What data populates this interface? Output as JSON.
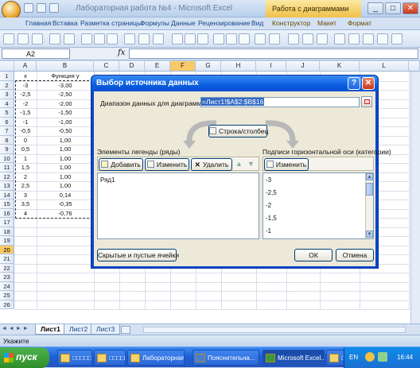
{
  "window": {
    "title": "Лабораторная работа №4 - Microsoft Excel",
    "context_tab": "Работа с диаграммами",
    "controls": {
      "minimize": "_",
      "maximize": "□",
      "close": "✕"
    }
  },
  "ribbon": {
    "tabs": [
      "Главная",
      "Вставка",
      "Разметка страницы",
      "Формулы",
      "Данные",
      "Рецензирование",
      "Вид",
      "Конструктор",
      "Макет",
      "Формат"
    ]
  },
  "formula_bar": {
    "name_box": "A2",
    "fx": "fx",
    "value": ""
  },
  "sheet": {
    "columns": [
      "A",
      "B",
      "C",
      "D",
      "E",
      "F",
      "G",
      "H",
      "I",
      "J",
      "K",
      "L"
    ],
    "rows": [
      "1",
      "2",
      "3",
      "4",
      "5",
      "6",
      "7",
      "8",
      "9",
      "10",
      "11",
      "12",
      "13",
      "14",
      "15",
      "16",
      "17",
      "18",
      "19",
      "20",
      "21",
      "22",
      "23",
      "24",
      "25",
      "26"
    ],
    "selected_rows": [
      "20"
    ],
    "header_row": {
      "a": "x",
      "b": "Функция y"
    },
    "data": [
      {
        "x": "-3",
        "y": "-3,00"
      },
      {
        "x": "-2,5",
        "y": "-2,50"
      },
      {
        "x": "-2",
        "y": "-2,00"
      },
      {
        "x": "-1,5",
        "y": "-1,50"
      },
      {
        "x": "-1",
        "y": "-1,00"
      },
      {
        "x": "-0,5",
        "y": "-0,50"
      },
      {
        "x": "0",
        "y": "1,00"
      },
      {
        "x": "0,5",
        "y": "1,00"
      },
      {
        "x": "1",
        "y": "1,00"
      },
      {
        "x": "1,5",
        "y": "1,00"
      },
      {
        "x": "2",
        "y": "1,00"
      },
      {
        "x": "2,5",
        "y": "1,00"
      },
      {
        "x": "3",
        "y": "0,14"
      },
      {
        "x": "3,5",
        "y": "-0,35"
      },
      {
        "x": "4",
        "y": "-0,76"
      }
    ],
    "tabs": [
      "Лист1",
      "Лист2",
      "Лист3"
    ],
    "active_tab": "Лист1"
  },
  "status": {
    "text": "Укажите"
  },
  "dialog": {
    "title": "Выбор источника данных",
    "range_label": "Диапазон данных для диаграммы:",
    "range_value": "=Лист1!$A$2:$B$16",
    "switch_button": "Строка/столбец",
    "legend_group": "Элементы легенды (ряды)",
    "add_button": "Добавить",
    "edit_button": "Изменить",
    "delete_button": "Удалить",
    "series": [
      "Ряд1"
    ],
    "axis_group": "Подписи горизонтальной оси (категории)",
    "axis_edit_button": "Изменить",
    "axis_labels": [
      "-3",
      "-2,5",
      "-2",
      "-1,5",
      "-1"
    ],
    "hidden_cells_button": "Скрытые и пустые ячейки",
    "ok_button": "ОК",
    "cancel_button": "Отмена"
  },
  "taskbar": {
    "start": "пуск",
    "items": [
      "□□□□□□□□",
      "□□□□□□□□",
      "Лабораторная",
      "Пояснительна...",
      "Microsoft Excel...",
      "□□□□□□□□□"
    ],
    "active_item": "Microsoft Excel...",
    "lang": "EN",
    "clock": "16:44"
  }
}
